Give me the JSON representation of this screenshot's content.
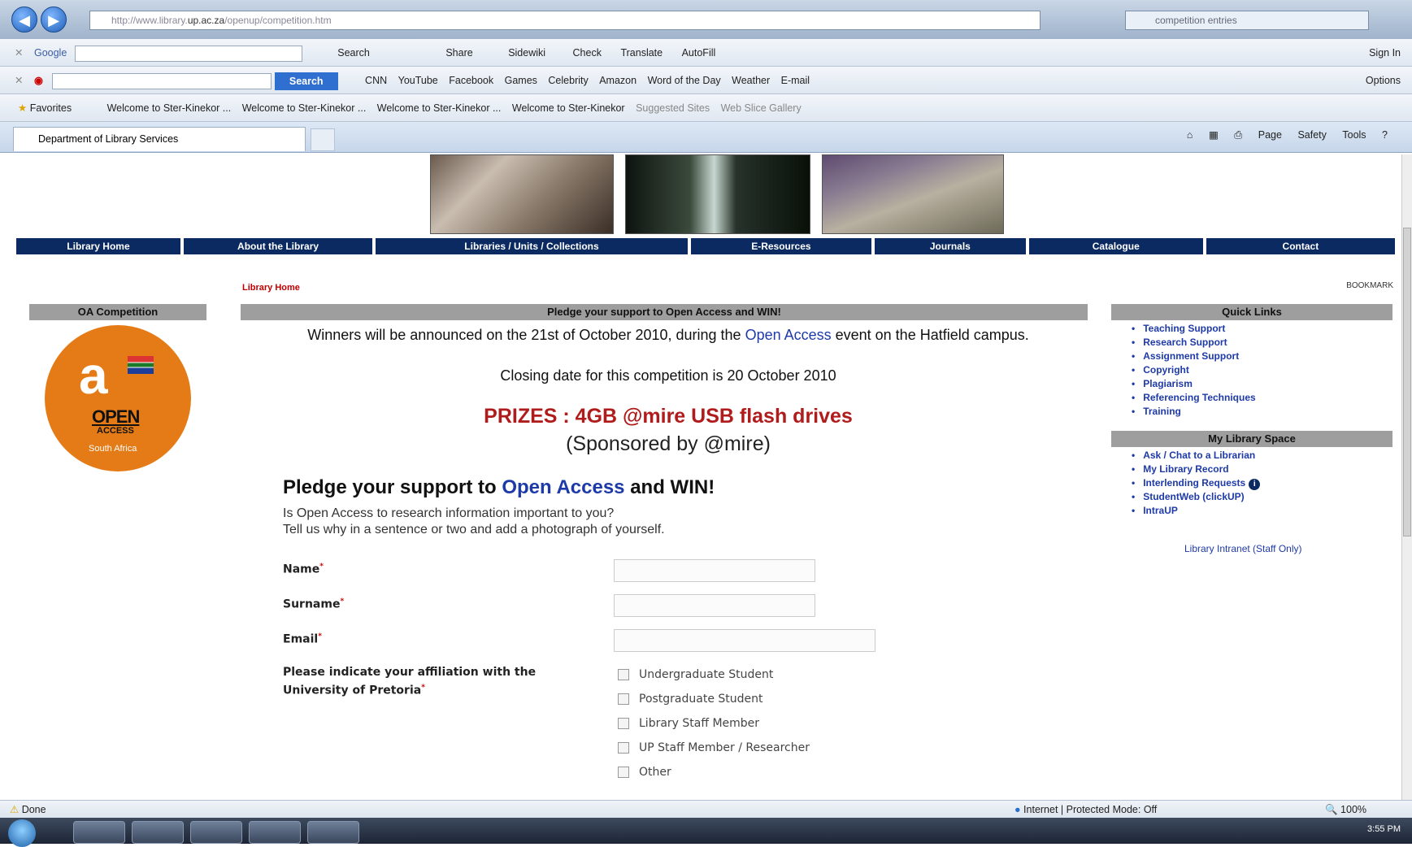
{
  "browser": {
    "url_prefix": "http://www.library.",
    "url_host": "up.ac.za",
    "url_path": "/openup/competition.htm",
    "search_tab_text": "competition entries",
    "google_toolbar": {
      "brand": "Google",
      "items": [
        "Search",
        "Share",
        "Sidewiki",
        "Check",
        "Translate",
        "AutoFill"
      ],
      "sign_in": "Sign In"
    },
    "search_toolbar": {
      "search_button": "Search",
      "items": [
        "CNN",
        "YouTube",
        "Facebook",
        "Games",
        "Celebrity",
        "Amazon",
        "Word of the Day",
        "Weather",
        "E-mail"
      ],
      "options": "Options"
    },
    "favorites_bar": {
      "favorites": "Favorites",
      "items": [
        "Welcome to Ster-Kinekor ...",
        "Welcome to Ster-Kinekor ...",
        "Welcome to Ster-Kinekor ...",
        "Welcome to Ster-Kinekor",
        "Suggested Sites",
        "Web Slice Gallery"
      ]
    },
    "tab_title": "Department of Library Services",
    "command_bar": [
      "Page",
      "Safety",
      "Tools"
    ],
    "status_left": "Done",
    "status_zone": "Internet | Protected Mode: Off",
    "zoom": "100%",
    "clock": "3:55 PM"
  },
  "site": {
    "menu": [
      "Library Home",
      "About the Library",
      "Libraries / Units / Collections",
      "E-Resources",
      "Journals",
      "Catalogue",
      "Contact"
    ],
    "breadcrumb": "Library Home",
    "bookmark_label": "BOOKMARK",
    "left": {
      "title": "OA Competition",
      "logo_letters": "a",
      "logo_open": "OPEN",
      "logo_access": "ACCESS",
      "logo_country": "South Africa"
    },
    "main": {
      "bar_title": "Pledge your support to Open Access and WIN!",
      "winners_a": "Winners will be announced on the 21st of October 2010, during the ",
      "winners_link": "Open Access",
      "winners_b": " event on the Hatfield campus.",
      "closing": "Closing date for this competition is 20 October 2010",
      "prizes": "PRIZES : 4GB @mire USB flash drives",
      "sponsor": "(Sponsored by @mire)",
      "form_head_a": "Pledge your support to ",
      "form_head_link": "Open Access",
      "form_head_b": " and WIN!",
      "form_sub_1": "Is Open Access to research information important to you?",
      "form_sub_2": "Tell us why in a sentence or two and add a photograph of yourself.",
      "fields": {
        "name": "Name",
        "surname": "Surname",
        "email": "Email",
        "affiliation_1": "Please indicate your affiliation with the",
        "affiliation_2": "University of Pretoria"
      },
      "required_mark": "*",
      "affiliations": [
        "Undergraduate Student",
        "Postgraduate Student",
        "Library Staff Member",
        "UP Staff Member / Researcher",
        "Other"
      ]
    },
    "right": {
      "quick_title": "Quick Links",
      "quick_links": [
        "Teaching Support",
        "Research Support",
        "Assignment Support",
        "Copyright",
        "Plagiarism",
        "Referencing Techniques",
        "Training"
      ],
      "space_title": "My Library Space",
      "space_links": [
        "Ask / Chat to a Librarian",
        "My Library Record",
        "Interlending Requests",
        "StudentWeb (clickUP)",
        "IntraUP"
      ],
      "intranet": "Library Intranet (Staff Only)"
    }
  },
  "icons": {
    "back": "back-arrow-icon",
    "forward": "forward-arrow-icon",
    "info": "info-icon"
  }
}
